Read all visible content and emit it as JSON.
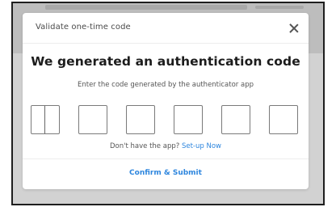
{
  "modal": {
    "header_title": "Validate one-time code",
    "heading": "We generated an authentication code",
    "subtext": "Enter the code generated by the authenticator app",
    "code_boxes": [
      "",
      "",
      "",
      "",
      "",
      ""
    ],
    "app_question": "Don't have the app?",
    "setup_link": "Set-up Now",
    "confirm_label": "Confirm & Submit"
  },
  "colors": {
    "link": "#2e86de",
    "overlay": "#d2d2d2",
    "text_dark": "#1c1c1c"
  },
  "icons": {
    "close": "close-icon"
  }
}
